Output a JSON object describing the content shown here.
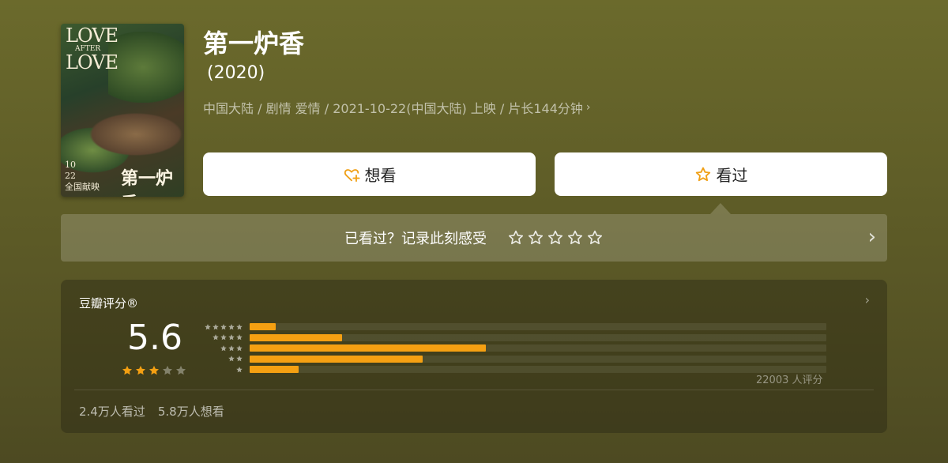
{
  "movie": {
    "title": "第一炉香",
    "year": "(2020)",
    "meta": "中国大陆 / 剧情 爱情 / 2021-10-22(中国大陆) 上映 / 片长144分钟",
    "meta_chevron": "›"
  },
  "poster": {
    "en_title_1": "LOVE",
    "en_title_2": "AFTER",
    "en_title_3": "LOVE",
    "cn_title": "第一炉香",
    "date_line_1": "10",
    "date_line_2": "22",
    "date_line_3": "全国献映"
  },
  "actions": {
    "want_label": "想看",
    "seen_label": "看过",
    "want_icon": "heart-plus-icon",
    "seen_icon": "star-outline-icon",
    "icon_color": "#f0a017"
  },
  "record": {
    "prompt": "已看过？记录此刻感受",
    "star_count": 5,
    "arrow": "›"
  },
  "rating": {
    "label": "豆瓣评分®",
    "arrow": "›",
    "score": "5.6",
    "stars_filled": 3,
    "stars_total": 5,
    "distribution": [
      {
        "stars": 5,
        "value": 0.045
      },
      {
        "stars": 4,
        "value": 0.16
      },
      {
        "stars": 3,
        "value": 0.41
      },
      {
        "stars": 2,
        "value": 0.3
      },
      {
        "stars": 1,
        "value": 0.085
      }
    ],
    "count": "22003 人评分",
    "watched": "2.4万人看过",
    "wanted": "5.8万人想看",
    "bar_color": "#f5a012",
    "star_color": "#f5a012"
  }
}
